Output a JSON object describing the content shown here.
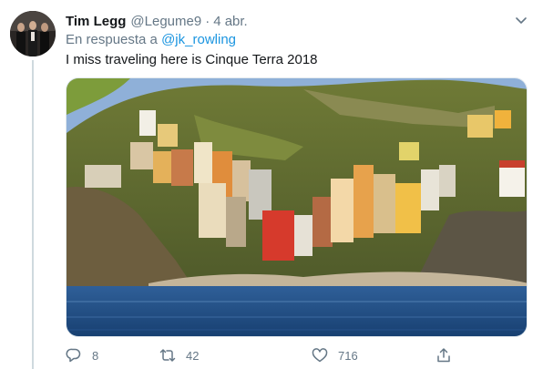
{
  "tweet": {
    "author_name": "Tim Legg",
    "author_handle": "@Legume9",
    "separator": "·",
    "date": "4 abr.",
    "reply_prefix": "En respuesta a",
    "reply_to": "@jk_rowling",
    "text": "I miss traveling here is Cinque Terra 2018"
  },
  "actions": {
    "replies": "8",
    "retweets": "42",
    "likes": "716"
  },
  "icons": {
    "reply": "reply-icon",
    "retweet": "retweet-icon",
    "like": "heart-icon",
    "share": "share-icon",
    "menu": "chevron-down-icon"
  },
  "colors": {
    "link": "#1b95e0",
    "secondary_text": "#657786",
    "primary_text": "#14171a"
  }
}
